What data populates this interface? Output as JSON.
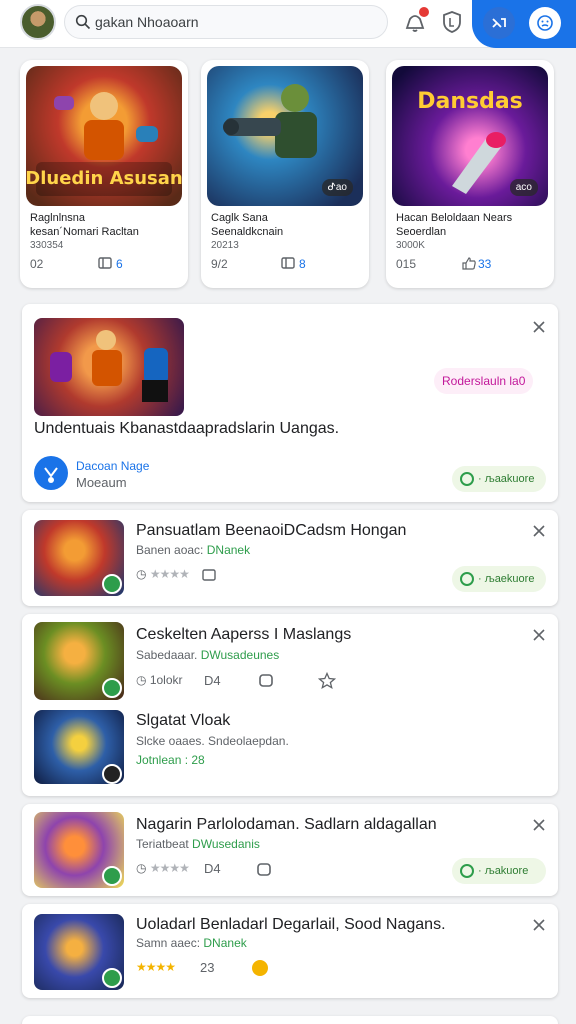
{
  "search": {
    "text": "gakan Nhoaoarn"
  },
  "featured": [
    {
      "line1": "Raglnlnsna",
      "line2": "kesan´Nomari Racltan",
      "line3": "330354",
      "stat": "02",
      "count": "6",
      "art_text": "Dluedin Asusan"
    },
    {
      "line1": "Caglk Sana",
      "line2": "Seenaldkcnain",
      "line3": "20213",
      "stat": "9/2",
      "count": "8",
      "badge": "ᕷaо"
    },
    {
      "line1": "Hacan Beloldaan Nears",
      "line2": "Seoerdlan",
      "line3": "3000K",
      "stat": "015",
      "count": "33",
      "badge": "асо",
      "art_text": "Dansdas"
    }
  ],
  "promo": {
    "pill": "Roderslauln la0",
    "description": "Undentuais Kbanastdaapradslarin Uangas.",
    "dev_name": "Dacoan Nage",
    "dev_sub": "Moeaum",
    "install": "· љaakuore"
  },
  "apps": [
    {
      "title": "Pansuatlam BeenaoiDCadsm Hongan",
      "sub_prefix": "Banen aoac:",
      "sub_green": "DNanek",
      "rating_text": "",
      "install": "· љaekuore"
    },
    {
      "title": "Ceskelten Aaperss I Maslangs",
      "sub_prefix": "Sabedaaar.",
      "sub_green": "DWusadeunes",
      "meta1": "1olokr",
      "meta2": "D4"
    },
    {
      "title": "Slgatat Vloak",
      "sub_prefix": "Slcke oaaes. Sndeolaepdan.",
      "sub_green": "Jotnlean : 28"
    },
    {
      "title": "Nagarin Parlolodaman. Sadlarn aldagallan",
      "sub_prefix": "Teriatbeat",
      "sub_green": "DWusedanis",
      "meta2": "D4",
      "install": "· љakuore"
    },
    {
      "title": "Uoladarl Benladarl Degarlail, Sood Nagans.",
      "sub_prefix": "Samn aaec:",
      "sub_green": "DNanek",
      "meta2": "23"
    }
  ],
  "colors": {
    "accent": "#1a73e8",
    "install_green": "#2e9d4b",
    "promo_pink": "#c2189a"
  }
}
